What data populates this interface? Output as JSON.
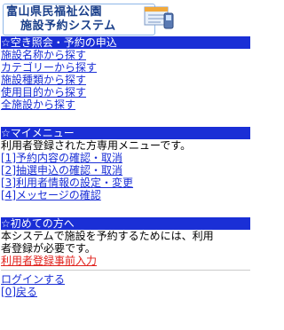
{
  "header": {
    "line1": "富山県民福祉公園",
    "line2": "施設予約システム"
  },
  "sections": {
    "search": {
      "title": "☆空き照会・予約の申込",
      "links": [
        "施設名称から探す",
        "カテゴリーから探す",
        "施設種類から探す",
        "使用目的から探す",
        "全施設から探す"
      ]
    },
    "mymenu": {
      "title": "☆マイメニュー",
      "description": "利用者登録された方専用メニューです。",
      "links": [
        "[1]予約内容の確認・取消",
        "[2]抽選申込の確認・取消",
        "[3]利用者情報の設定・変更",
        "[4]メッセージの確認"
      ]
    },
    "firsttime": {
      "title": "☆初めての方へ",
      "description_line1": "本システムで施設を予約するためには、利用",
      "description_line2": "者登録が必要です。",
      "register_link": "利用者登録事前入力"
    }
  },
  "footer": {
    "login_link": "ログインする",
    "back_link": "[0]戻る"
  },
  "colors": {
    "section_bar": "#1a2fd6",
    "link": "#1a2fd6",
    "register_link": "#e0201b"
  }
}
